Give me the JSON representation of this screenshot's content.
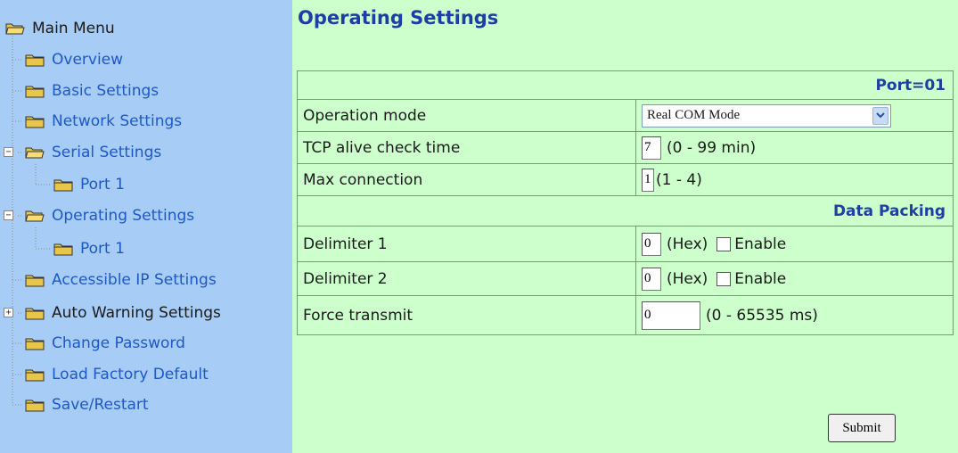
{
  "menu": {
    "root": "Main Menu",
    "items": [
      {
        "label": "Overview"
      },
      {
        "label": "Basic Settings"
      },
      {
        "label": "Network Settings"
      },
      {
        "label": "Serial Settings"
      },
      {
        "label": "Port 1"
      },
      {
        "label": "Operating Settings"
      },
      {
        "label": "Port 1"
      },
      {
        "label": "Accessible IP Settings"
      },
      {
        "label": "Auto Warning Settings"
      },
      {
        "label": "Change Password"
      },
      {
        "label": "Load Factory Default"
      },
      {
        "label": "Save/Restart"
      }
    ],
    "expand_minus": "−",
    "expand_plus": "+"
  },
  "page": {
    "title": "Operating Settings",
    "port_header": "Port=01",
    "operation_mode": {
      "label": "Operation mode",
      "value": "Real COM Mode"
    },
    "tcp_alive": {
      "label": "TCP alive check time",
      "value": "7",
      "suffix": "(0 - 99 min)"
    },
    "max_connection": {
      "label": "Max connection",
      "value": "1",
      "suffix": "(1 - 4)"
    },
    "data_packing_header": "Data Packing",
    "delimiter1": {
      "label": "Delimiter 1",
      "value": "0",
      "suffix": "(Hex)",
      "enable_label": "Enable"
    },
    "delimiter2": {
      "label": "Delimiter 2",
      "value": "0",
      "suffix": "(Hex)",
      "enable_label": "Enable"
    },
    "force_transmit": {
      "label": "Force transmit",
      "value": "0",
      "suffix": "(0 - 65535 ms)"
    },
    "submit_label": "Submit"
  },
  "colors": {
    "sidebar_bg": "#a7cdf6",
    "main_bg": "#ccffcc",
    "link": "#1f57c7",
    "heading": "#1f3ea5",
    "folder": "#e8c64a"
  },
  "icons": [
    "folder-icon",
    "open-folder-icon",
    "expand-minus-icon",
    "expand-plus-icon",
    "dropdown-arrow-icon"
  ]
}
